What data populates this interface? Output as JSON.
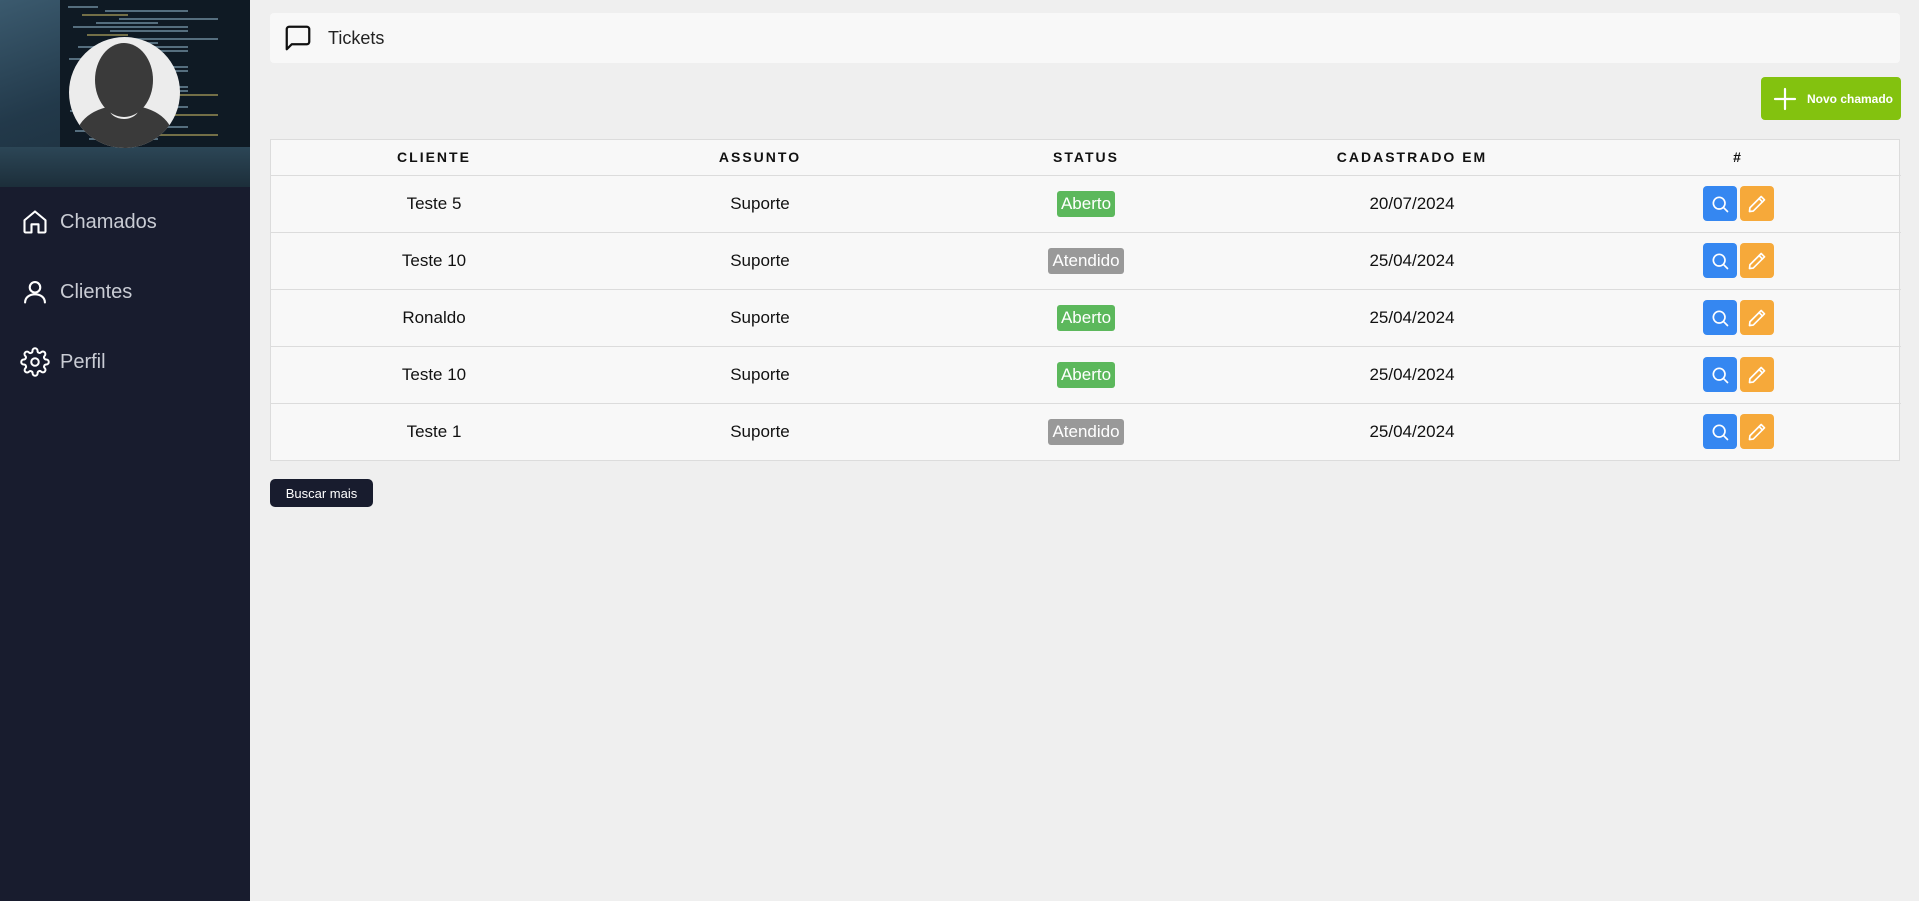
{
  "sidebar": {
    "items": [
      {
        "label": "Chamados",
        "icon": "home-icon"
      },
      {
        "label": "Clientes",
        "icon": "user-icon"
      },
      {
        "label": "Perfil",
        "icon": "gear-icon"
      }
    ]
  },
  "header": {
    "title": "Tickets",
    "icon": "message-square-icon"
  },
  "new_ticket_button": {
    "label": "Novo chamado",
    "icon": "plus-icon"
  },
  "table": {
    "headers": [
      "CLIENTE",
      "ASSUNTO",
      "STATUS",
      "CADASTRADO EM",
      "#"
    ],
    "rows": [
      {
        "cliente": "Teste 5",
        "assunto": "Suporte",
        "status": "Aberto",
        "cadastrado": "20/07/2024"
      },
      {
        "cliente": "Teste 10",
        "assunto": "Suporte",
        "status": "Atendido",
        "cadastrado": "25/04/2024"
      },
      {
        "cliente": "Ronaldo",
        "assunto": "Suporte",
        "status": "Aberto",
        "cadastrado": "25/04/2024"
      },
      {
        "cliente": "Teste 10",
        "assunto": "Suporte",
        "status": "Aberto",
        "cadastrado": "25/04/2024"
      },
      {
        "cliente": "Teste 1",
        "assunto": "Suporte",
        "status": "Atendido",
        "cadastrado": "25/04/2024"
      }
    ]
  },
  "load_more_button": {
    "label": "Buscar mais"
  },
  "colors": {
    "sidebar_bg": "#181c2e",
    "new_button": "#83c20f",
    "status_aberto": "#5cb85c",
    "status_atendido": "#999999",
    "search_button": "#3587f1",
    "edit_button": "#f6a93a"
  }
}
